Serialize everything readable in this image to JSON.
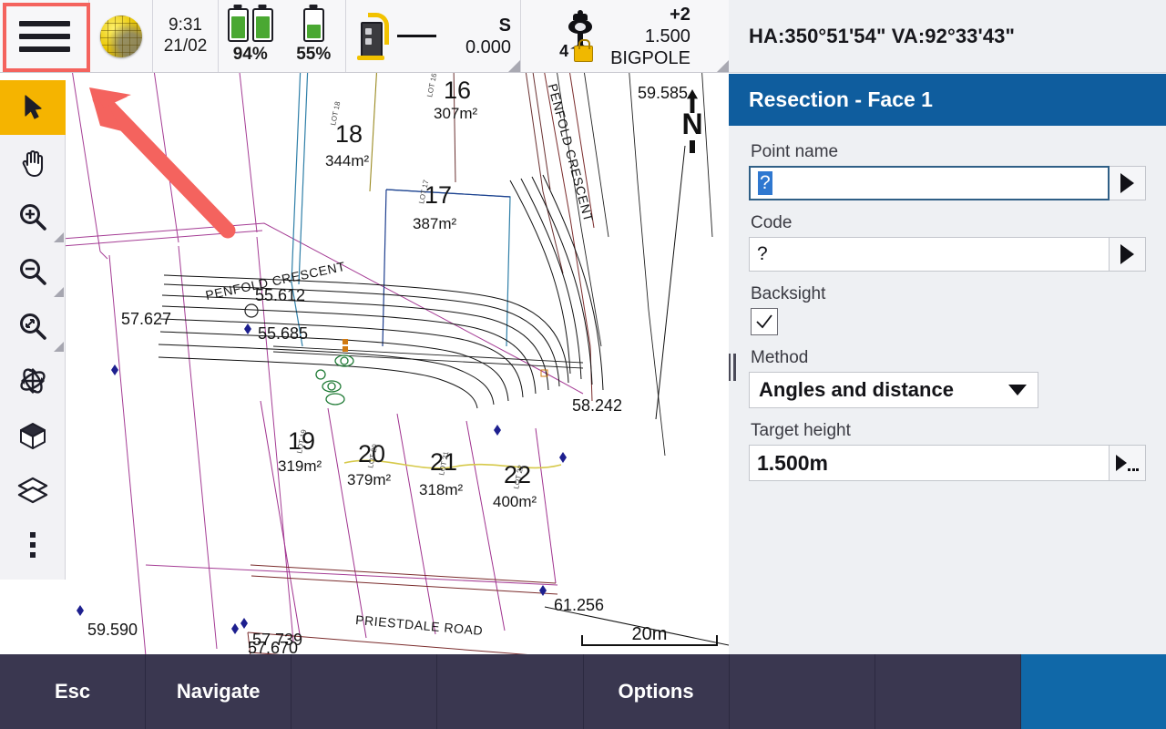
{
  "statusbar": {
    "menu_icon": "hamburger-menu-icon",
    "globe_icon": "globe-icon",
    "time": "9:31",
    "date": "21/02",
    "battery_1_pct": "94%",
    "battery_2_pct": "55%",
    "instrument_icon": "total-station-icon",
    "instrument_mode": "S",
    "instrument_distance": "0.000",
    "target_icon": "prism-target-icon",
    "target_number": "4",
    "lock_icon": "lock-icon",
    "target_offset": "+2",
    "target_height": "1.500",
    "target_name": "BIGPOLE"
  },
  "angle_readout": {
    "text": "HA:350°51'54\"  VA:92°33'43\""
  },
  "panel": {
    "title": "Resection - Face 1",
    "title_bg": "#0f5d9e",
    "fields": {
      "point_name_label": "Point name",
      "point_name_value": "?",
      "code_label": "Code",
      "code_value": "?",
      "backsight_label": "Backsight",
      "backsight_checked": true,
      "method_label": "Method",
      "method_value": "Angles and distance",
      "target_height_label": "Target height",
      "target_height_value": "1.500m"
    },
    "icons": {
      "point_name_arrow": "triangle-right-icon",
      "code_arrow": "triangle-right-icon",
      "method_chevron": "chevron-down-icon",
      "target_height_arrow": "triangle-right-more-icon",
      "check": "check-icon"
    }
  },
  "toolbar": {
    "items": [
      {
        "name": "select-tool",
        "icon": "cursor-arrow-icon",
        "active": true,
        "submenu": false
      },
      {
        "name": "pan-tool",
        "icon": "hand-pan-icon",
        "active": false,
        "submenu": false
      },
      {
        "name": "zoom-in-tool",
        "icon": "magnifier-plus-icon",
        "active": false,
        "submenu": true
      },
      {
        "name": "zoom-out-tool",
        "icon": "magnifier-minus-icon",
        "active": false,
        "submenu": true
      },
      {
        "name": "zoom-extents-tool",
        "icon": "magnifier-extents-icon",
        "active": false,
        "submenu": true
      },
      {
        "name": "orbit-tool",
        "icon": "orbit-rotate-icon",
        "active": false,
        "submenu": false
      },
      {
        "name": "view-3d-tool",
        "icon": "cube-icon",
        "active": false,
        "submenu": false
      },
      {
        "name": "layers-tool",
        "icon": "layers-icon",
        "active": false,
        "submenu": false
      },
      {
        "name": "more-tool",
        "icon": "more-vertical-icon",
        "active": false,
        "submenu": false
      }
    ]
  },
  "map": {
    "north_label": "N",
    "north_icon": "north-arrow-icon",
    "scale_label": "20m",
    "lots": [
      {
        "number": "16",
        "area": "307m²",
        "side": "LOT 16"
      },
      {
        "number": "18",
        "area": "344m²",
        "side": "LOT 18"
      },
      {
        "number": "17",
        "area": "387m²",
        "side": "LOT 17"
      },
      {
        "number": "19",
        "area": "319m²",
        "side": "LOT 19"
      },
      {
        "number": "20",
        "area": "379m²",
        "side": "LOT 20"
      },
      {
        "number": "21",
        "area": "318m²",
        "side": "LOT 21"
      },
      {
        "number": "22",
        "area": "400m²",
        "side": "LOT 22"
      }
    ],
    "roads": [
      {
        "name": "PENFOLD CRESCENT"
      },
      {
        "name": "PENFOLD CRESCENT"
      },
      {
        "name": "PRIESTDALE ROAD"
      }
    ],
    "elevations": [
      "59.585",
      "57.627",
      "55.612",
      "55.685",
      "58.242",
      "61.256",
      "59.590",
      "57.739",
      "57.670"
    ]
  },
  "bottombar": {
    "buttons": [
      {
        "label": "Esc",
        "accent": false
      },
      {
        "label": "Navigate",
        "accent": false
      },
      {
        "label": "",
        "accent": false
      },
      {
        "label": "",
        "accent": false
      },
      {
        "label": "Options",
        "accent": false
      },
      {
        "label": "",
        "accent": false
      },
      {
        "label": "",
        "accent": false
      },
      {
        "label": "",
        "accent": true
      }
    ],
    "bg": "#3a3750",
    "accent": "#1068a8"
  },
  "annotations": {
    "highlight_color": "#f4635e",
    "highlight_target": "hamburger-menu-icon"
  }
}
